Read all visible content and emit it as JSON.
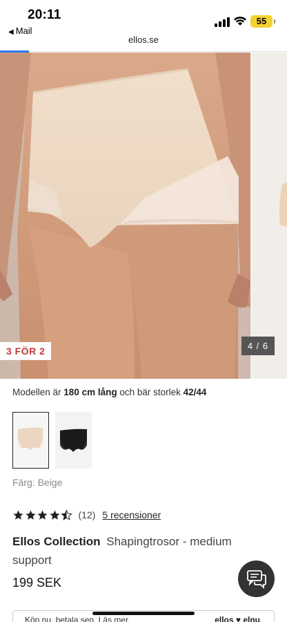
{
  "status_bar": {
    "time": "20:11",
    "back_app": "Mail",
    "battery": "55",
    "battery_color": "#f2d230"
  },
  "browser": {
    "url": "ellos.se"
  },
  "gallery": {
    "promo_badge": "3 FÖR 2",
    "counter": "4 / 6",
    "current_image": 4,
    "total_images": 6
  },
  "model_info": {
    "prefix": "Modellen är ",
    "height": "180 cm lång",
    "middle": " och bär storlek ",
    "size": "42/44"
  },
  "swatches": [
    {
      "name": "Beige",
      "selected": true
    },
    {
      "name": "Svart",
      "selected": false
    }
  ],
  "color": {
    "label": "Färg: Beige"
  },
  "rating": {
    "value": 4.5,
    "max": 5,
    "count": "(12)",
    "reviews_link": "5 recensioner"
  },
  "product": {
    "brand": "Ellos Collection",
    "name": "Shapingtrosor - medium support",
    "price": "199 SEK"
  },
  "banner": {
    "text": "Köp nu, betala sen. Läs mer",
    "logo": "ellos ♥ elnu"
  },
  "colors": {
    "promo_red": "#c23a3a",
    "link_blue": "#2d7bf0",
    "chat_bg": "#333333"
  }
}
